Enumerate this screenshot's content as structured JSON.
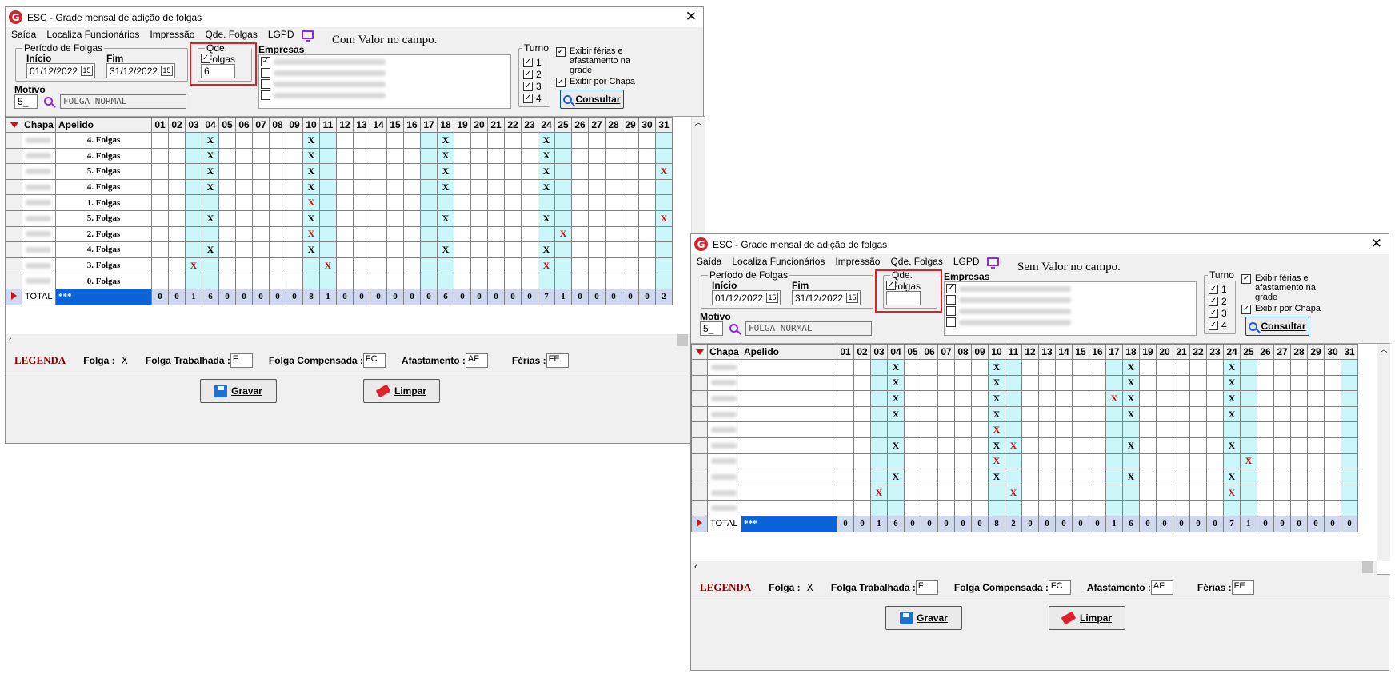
{
  "window1": {
    "title": "ESC - Grade mensal de adição de folgas",
    "note": "Com Valor no campo.",
    "qde_value": "6",
    "qde_checked": "✓",
    "rows": [
      {
        "apelido": "4. Folgas",
        "x": {
          "4": "b",
          "10": "b",
          "18": "b",
          "24": "b"
        }
      },
      {
        "apelido": "4. Folgas",
        "x": {
          "4": "b",
          "10": "b",
          "18": "b",
          "24": "b"
        }
      },
      {
        "apelido": "5. Folgas",
        "x": {
          "4": "b",
          "10": "b",
          "18": "b",
          "24": "b",
          "31": "r"
        }
      },
      {
        "apelido": "4. Folgas",
        "x": {
          "4": "b",
          "10": "b",
          "18": "b",
          "24": "b"
        }
      },
      {
        "apelido": "1. Folgas",
        "x": {
          "10": "r"
        }
      },
      {
        "apelido": "5. Folgas",
        "x": {
          "4": "b",
          "10": "b",
          "18": "b",
          "24": "b",
          "31": "r"
        }
      },
      {
        "apelido": "2. Folgas",
        "x": {
          "10": "r",
          "25": "r"
        }
      },
      {
        "apelido": "4. Folgas",
        "x": {
          "4": "b",
          "10": "b",
          "18": "b",
          "24": "b"
        }
      },
      {
        "apelido": "3. Folgas",
        "x": {
          "3": "r",
          "11": "r",
          "24": "r"
        }
      },
      {
        "apelido": "0. Folgas",
        "x": {}
      }
    ],
    "totals": [
      "0",
      "0",
      "1",
      "6",
      "0",
      "0",
      "0",
      "0",
      "0",
      "8",
      "1",
      "0",
      "0",
      "0",
      "0",
      "0",
      "0",
      "6",
      "0",
      "0",
      "0",
      "0",
      "0",
      "7",
      "1",
      "0",
      "0",
      "0",
      "0",
      "0",
      "2"
    ]
  },
  "window2": {
    "title": "ESC - Grade mensal de adição de folgas",
    "note": "Sem Valor no campo.",
    "qde_value": "",
    "qde_checked": "✓",
    "rows": [
      {
        "apelido": "",
        "x": {
          "4": "b",
          "10": "b",
          "18": "b",
          "24": "b"
        }
      },
      {
        "apelido": "",
        "x": {
          "4": "b",
          "10": "b",
          "18": "b",
          "24": "b"
        }
      },
      {
        "apelido": "",
        "x": {
          "4": "b",
          "10": "b",
          "17": "r",
          "18": "b",
          "24": "b"
        }
      },
      {
        "apelido": "",
        "x": {
          "4": "b",
          "10": "b",
          "18": "b",
          "24": "b"
        }
      },
      {
        "apelido": "",
        "x": {
          "10": "r"
        }
      },
      {
        "apelido": "",
        "x": {
          "4": "b",
          "10": "b",
          "11": "r",
          "18": "b",
          "24": "b"
        }
      },
      {
        "apelido": "",
        "x": {
          "10": "r",
          "25": "r"
        }
      },
      {
        "apelido": "",
        "x": {
          "4": "b",
          "10": "b",
          "18": "b",
          "24": "b"
        }
      },
      {
        "apelido": "",
        "x": {
          "3": "r",
          "11": "r",
          "24": "r"
        }
      },
      {
        "apelido": "",
        "x": {}
      }
    ],
    "totals": [
      "0",
      "0",
      "1",
      "6",
      "0",
      "0",
      "0",
      "0",
      "0",
      "8",
      "2",
      "0",
      "0",
      "0",
      "0",
      "0",
      "1",
      "6",
      "0",
      "0",
      "0",
      "0",
      "0",
      "7",
      "1",
      "0",
      "0",
      "0",
      "0",
      "0",
      "0"
    ]
  },
  "common": {
    "menu": [
      "Saída",
      "Localiza Funcionários",
      "Impressão",
      "Qde. Folgas",
      "LGPD"
    ],
    "periodo_label": "Período de Folgas",
    "inicio_label": "Início",
    "fim_label": "Fim",
    "inicio_value": "01/12/2022",
    "fim_value": "31/12/2022",
    "cal_icon": "15",
    "qde_label": "Qde. Folgas",
    "empresas_label": "Empresas",
    "turno_label": "Turno",
    "turnos": [
      "1",
      "2",
      "3",
      "4"
    ],
    "exibir_ferias": "Exibir férias e afastamento na grade",
    "exibir_chapa": "Exibir por Chapa",
    "consultar": "Consultar",
    "motivo_label": "Motivo",
    "motivo_code": "5_",
    "motivo_desc": "FOLGA NORMAL",
    "col_chapa": "Chapa",
    "col_apelido": "Apelido",
    "days": [
      "01",
      "02",
      "03",
      "04",
      "05",
      "06",
      "07",
      "08",
      "09",
      "10",
      "11",
      "12",
      "13",
      "14",
      "15",
      "16",
      "17",
      "18",
      "19",
      "20",
      "21",
      "22",
      "23",
      "24",
      "25",
      "26",
      "27",
      "28",
      "29",
      "30",
      "31"
    ],
    "highlight_days": [
      3,
      4,
      10,
      11,
      17,
      18,
      24,
      25,
      31
    ],
    "total_label": "TOTAL",
    "total_stars": "***",
    "legenda": "LEGENDA",
    "folga_label": "Folga :",
    "folga_symbol": "X",
    "folga_trab_label": "Folga Trabalhada :",
    "folga_trab_val": "F",
    "folga_comp_label": "Folga Compensada :",
    "folga_comp_val": "FC",
    "afast_label": "Afastamento :",
    "afast_val": "AF",
    "ferias_label": "Férias :",
    "ferias_val": "FE",
    "gravar": "Gravar",
    "limpar": "Limpar",
    "check_mark": "✓",
    "accent_red": "#e02020",
    "highlight_color": "#ccf7fa"
  }
}
